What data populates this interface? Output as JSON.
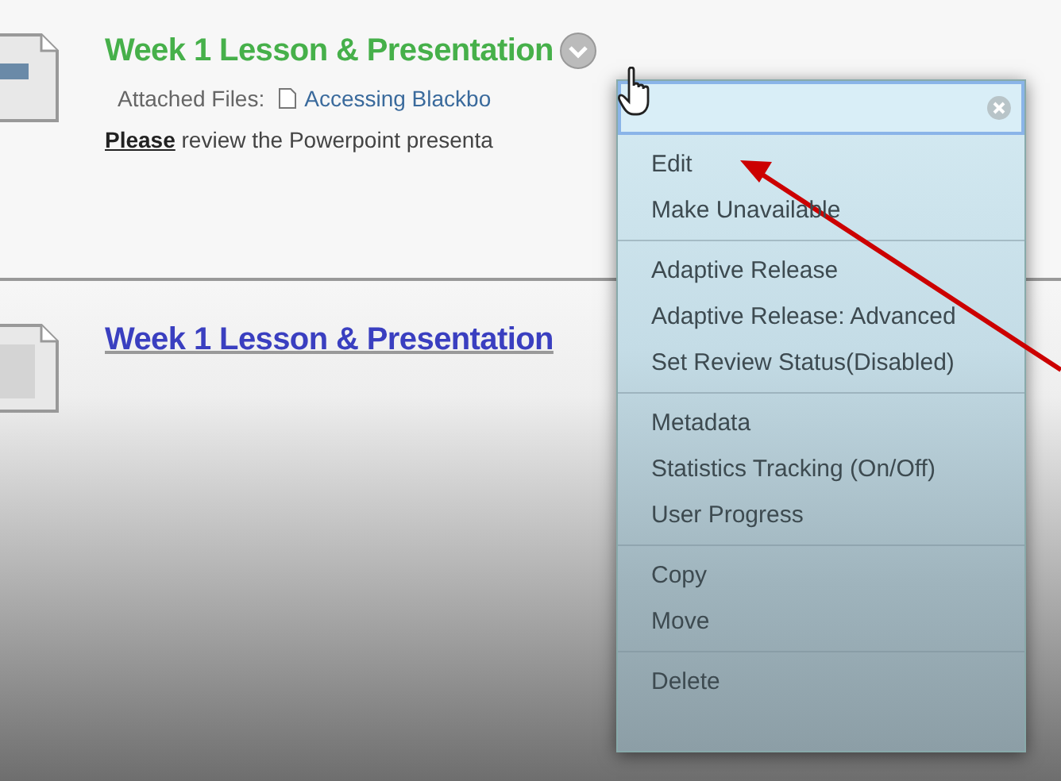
{
  "content_items": [
    {
      "title": "Week 1 Lesson & Presentation",
      "hovered": true,
      "attached_label": "Attached Files:",
      "attached_file": "Accessing Blackbo",
      "description": "**Please** review the Powerpoint presenta"
    },
    {
      "title": "Week 1 Lesson & Presentation",
      "hovered": false
    }
  ],
  "context_menu": {
    "groups": [
      [
        "Edit",
        "Make Unavailable"
      ],
      [
        "Adaptive Release",
        "Adaptive Release: Advanced",
        "Set Review Status(Disabled)"
      ],
      [
        "Metadata",
        "Statistics Tracking (On/Off)",
        "User Progress"
      ],
      [
        "Copy",
        "Move"
      ],
      [
        "Delete"
      ]
    ]
  }
}
